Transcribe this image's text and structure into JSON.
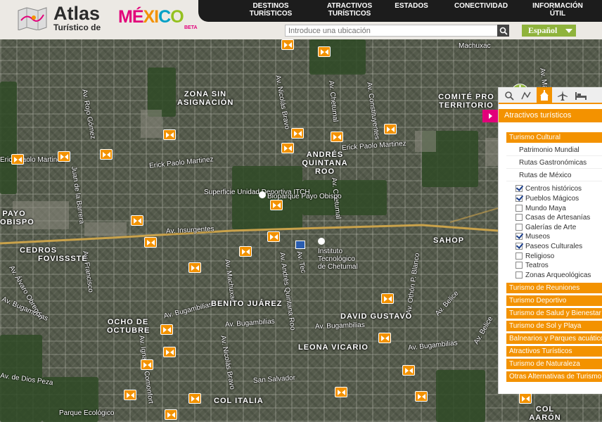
{
  "logo": {
    "atlas": "Atlas",
    "subtitle": "Turístico de",
    "mexico_letters": [
      "MÉ",
      "XI",
      "C",
      "O"
    ],
    "beta": "BETA"
  },
  "nav": [
    {
      "line1": "DESTINOS",
      "line2": "TURÍSTICOS"
    },
    {
      "line1": "ATRACTIVOS",
      "line2": "TURÍSTICOS"
    },
    {
      "line1": "ESTADOS",
      "line2": ""
    },
    {
      "line1": "CONECTIVIDAD",
      "line2": ""
    },
    {
      "line1": "INFORMACIÓN",
      "line2": "ÚTIL"
    }
  ],
  "search": {
    "placeholder": "Introduce una ubicación"
  },
  "language": {
    "selected": "Español"
  },
  "map": {
    "streets": [
      "Machuxac",
      "Av. Constituyentes",
      "Av. Chetumal",
      "Av. Nicolás Bravo",
      "Av. Rojo Gómez",
      "Juan de la Barrera",
      "Erick Paolo Martinez",
      "Erick Paolo Martinez",
      "Erick Paolo Martinez",
      "Av. Insurgentes",
      "Av. Bugambilias",
      "Av. Bugambilias",
      "Av. Bugambilias",
      "Av. Bugambilias",
      "San Salvador",
      "Av. Belice",
      "Av. Chetumal",
      "Av. Andrés Quintana Roo",
      "Av. Othón P. Blanco",
      "Av. Francisco",
      "Av. Machuxac",
      "Av. de Dios Peza",
      "Av. Bugambilias",
      "Av. Álvaro Obregón",
      "Av. Nicolás Bravo",
      "Av. Ignacio Comonfort",
      "Av. Machuxac",
      "Av. Tec",
      "Av. Belice"
    ],
    "places": [
      "Superficie Unidad Deportiva ITCH",
      "Bioparque Payo Obispo",
      "Instituto Tecnológico de Chetumal",
      "Parque Ecológico"
    ],
    "areas": [
      "ZONA SIN ASIGNACIÓN",
      "ANDRÉS QUINTANA ROO",
      "COMITÉ PRO TERRITORIO",
      "CEDROS",
      "FOVISSSTE",
      "BENITO JUÁREZ",
      "DAVID GUSTAVO",
      "OCHO DE OCTUBRE",
      "LEONA VICARIO",
      "COL ITALIA",
      "SAHOP",
      "PAYO OBISPO",
      "COL AARÓN MERINO"
    ]
  },
  "panel": {
    "header": "Atractivos turísticos",
    "culture": "Turismo Cultural",
    "cultural_subs": [
      "Patrimonio Mundial",
      "Rutas Gastronómicas",
      "Rutas de México"
    ],
    "checkboxes": [
      {
        "label": "Centros históricos",
        "checked": true
      },
      {
        "label": "Pueblos Mágicos",
        "checked": true
      },
      {
        "label": "Mundo Maya",
        "checked": false
      },
      {
        "label": "Casas de Artesanías",
        "checked": false
      },
      {
        "label": "Galerías de Arte",
        "checked": false
      },
      {
        "label": "Museos",
        "checked": true
      },
      {
        "label": "Paseos Culturales",
        "checked": true
      },
      {
        "label": "Religioso",
        "checked": false
      },
      {
        "label": "Teatros",
        "checked": false
      },
      {
        "label": "Zonas Arqueológicas",
        "checked": false
      }
    ],
    "categories": [
      "Turismo de Reuniones",
      "Turismo Deportivo",
      "Turismo de Salud y Bienestar",
      "Turismo de Sol y Playa",
      "Balnearios y Parques acuáticos",
      "Atractivos Turísticos",
      "Turismo de Naturaleza",
      "Otras Alternativas de Turismo"
    ]
  },
  "colors": {
    "accent": "#f39200",
    "brand_pink": "#e2007a",
    "lang_green": "#8fb33c",
    "nav_bg": "#1c1c1c"
  }
}
